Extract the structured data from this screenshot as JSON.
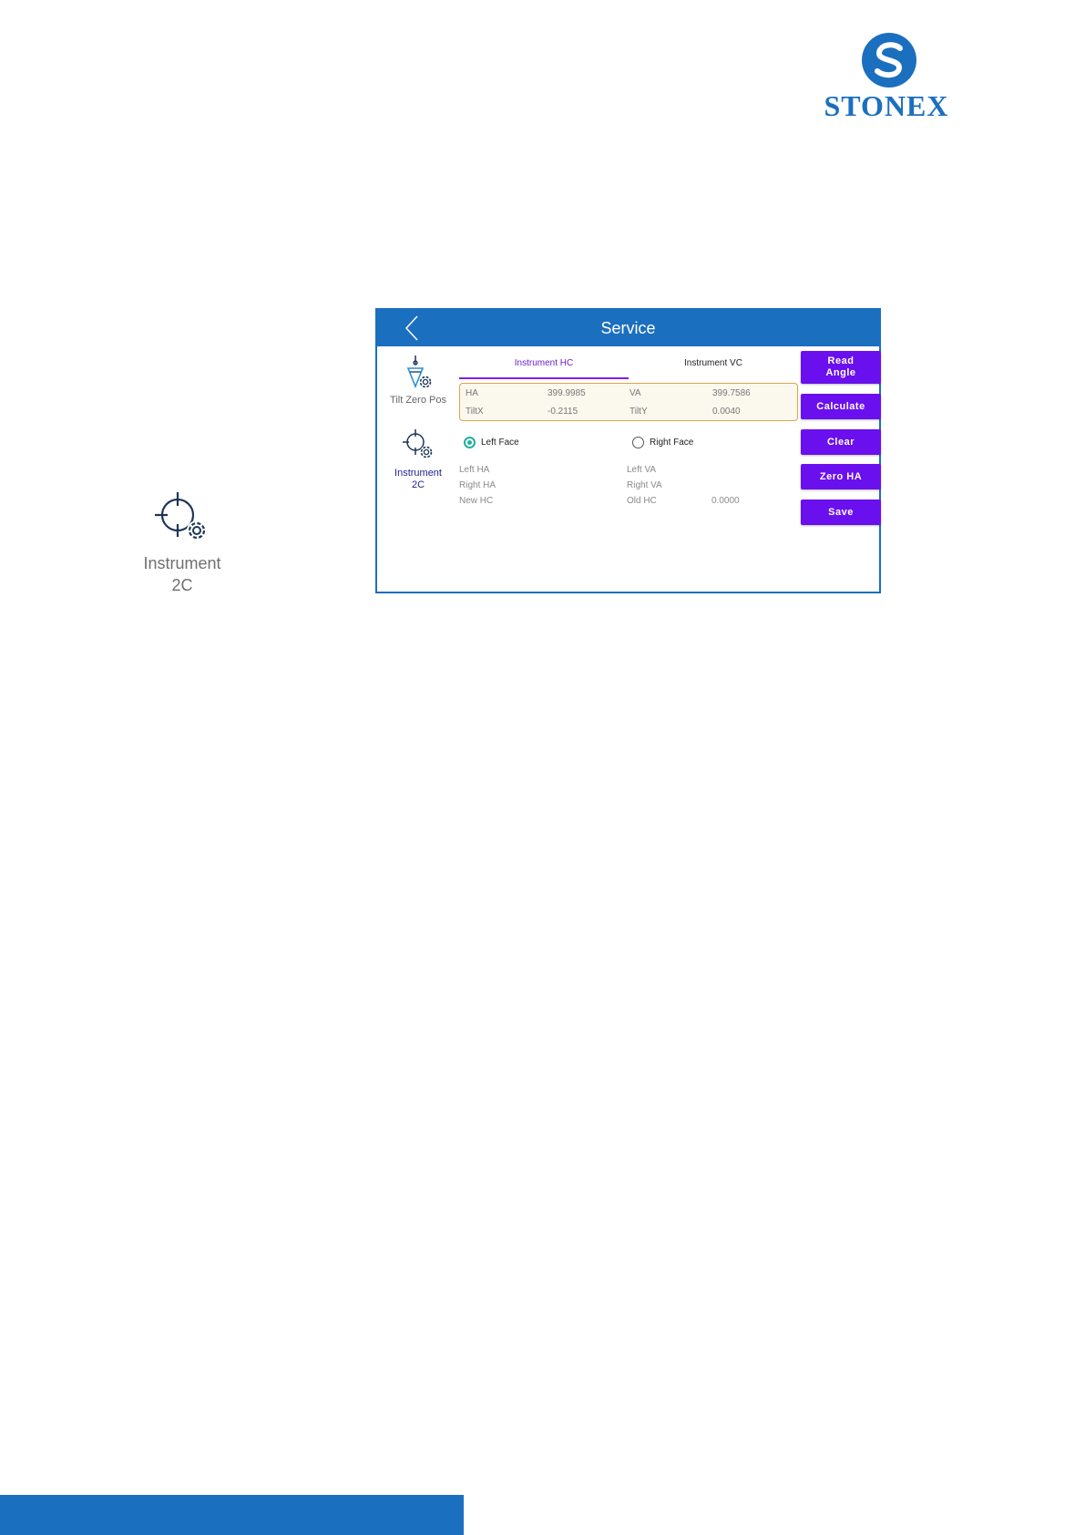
{
  "logo": {
    "text": "STONEX"
  },
  "big_icon": {
    "label_line1": "Instrument",
    "label_line2": "2C",
    "icon": "crosshair-gear-icon"
  },
  "screen": {
    "title": "Service",
    "side": [
      {
        "label": "Tilt Zero Pos",
        "icon": "plumb-gear-icon"
      },
      {
        "label_line1": "Instrument",
        "label_line2": "2C",
        "icon": "crosshair-gear-icon"
      }
    ],
    "tabs": [
      "Instrument HC",
      "Instrument VC"
    ],
    "readings": {
      "ha_label": "HA",
      "ha_value": "399.9985",
      "va_label": "VA",
      "va_value": "399.7586",
      "tiltx_label": "TiltX",
      "tiltx_value": "-0.2115",
      "tilty_label": "TiltY",
      "tilty_value": "0.0040"
    },
    "radios": {
      "left": "Left Face",
      "right": "Right Face"
    },
    "fields": {
      "left_ha": "Left HA",
      "right_ha": "Right HA",
      "new_hc": "New HC",
      "left_va": "Left VA",
      "right_va": "Right VA",
      "old_hc": "Old HC",
      "old_hc_value": "0.0000"
    },
    "buttons": {
      "read_angle_1": "Read",
      "read_angle_2": "Angle",
      "calculate": "Calculate",
      "clear": "Clear",
      "zero_ha": "Zero HA",
      "save": "Save"
    }
  }
}
